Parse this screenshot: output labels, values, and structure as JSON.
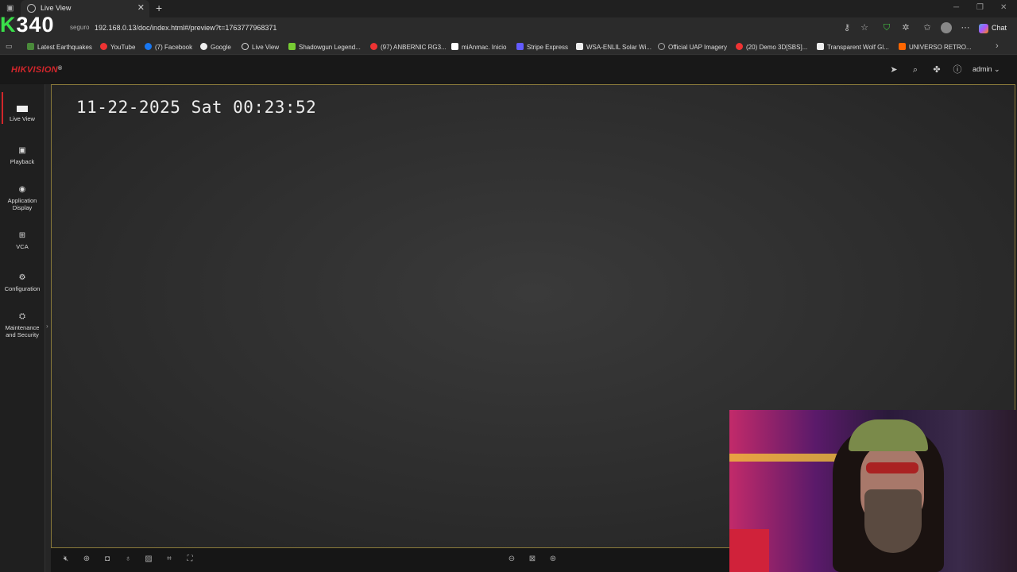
{
  "browser": {
    "tab_title": "Live View",
    "new_tab": "+",
    "not_secure": "seguro",
    "url": "192.168.0.13/doc/index.html#/preview?t=1763777968371",
    "chat_label": "Chat",
    "stream_overlay": "340",
    "stream_overlay_prefix": "K",
    "bookmarks": [
      {
        "label": "Latest Earthquakes",
        "color": "#4a8a3a"
      },
      {
        "label": "YouTube",
        "color": "#e33"
      },
      {
        "label": "(7) Facebook",
        "color": "#1877f2"
      },
      {
        "label": "Google",
        "color": "#eee"
      },
      {
        "label": "Live View",
        "color": "#ddd"
      },
      {
        "label": "Shadowgun Legend...",
        "color": "#7c3"
      },
      {
        "label": "(97) ANBERNIC RG3...",
        "color": "#e33"
      },
      {
        "label": "miAnmac. Inicio",
        "color": "#fff"
      },
      {
        "label": "Stripe Express",
        "color": "#635bff"
      },
      {
        "label": "WSA-ENLIL Solar Wi...",
        "color": "#eee"
      },
      {
        "label": "Official UAP Imagery",
        "color": "#aaa"
      },
      {
        "label": "(20) Demo 3D[SBS]...",
        "color": "#e33"
      },
      {
        "label": "Transparent Wolf Gl...",
        "color": "#eee"
      },
      {
        "label": "UNIVERSO RETRO...",
        "color": "#f60"
      }
    ]
  },
  "app": {
    "logo": "HIKVISION",
    "logo_reg": "®",
    "user": "admin"
  },
  "nav": [
    {
      "label": "Live View",
      "icon": "live-view-icon"
    },
    {
      "label": "Playback",
      "icon": "playback-icon"
    },
    {
      "label": "Application Display",
      "icon": "application-icon"
    },
    {
      "label": "VCA",
      "icon": "vca-icon"
    },
    {
      "label": "Configuration",
      "icon": "gear-icon"
    },
    {
      "label": "Maintenance and Security",
      "icon": "maintenance-icon"
    }
  ],
  "video": {
    "osd_timestamp": "11-22-2025 Sat 00:23:52"
  },
  "colors": {
    "brand": "#d2262b",
    "video_border": "#8a7a3a"
  }
}
